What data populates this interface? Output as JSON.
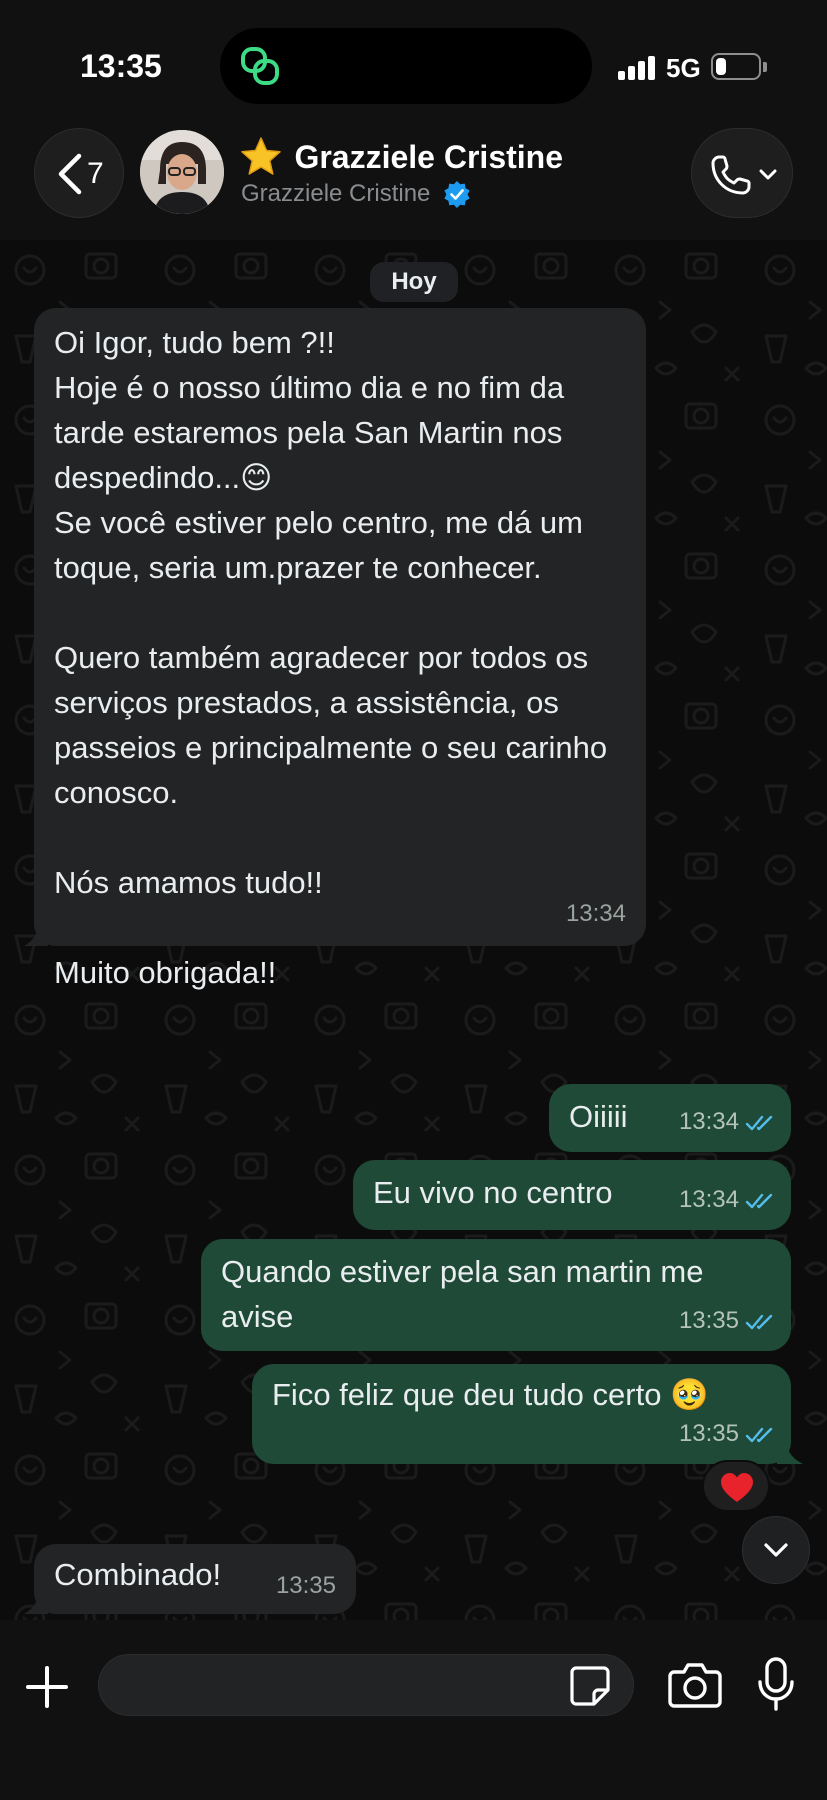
{
  "status_bar": {
    "time": "13:35",
    "network": "5G",
    "battery_level": 0.25
  },
  "header": {
    "back_count": "7",
    "contact_name": "Grazziele Cristine",
    "contact_subtitle": "Grazziele Cristine",
    "name_emoji": "star-icon",
    "verified": true
  },
  "chat": {
    "date_label": "Hoy",
    "messages": [
      {
        "direction": "incoming",
        "text": "Oi Igor, tudo bem ?!!\nHoje é o nosso último dia e no fim da tarde estaremos pela San Martin nos despedindo...😊\nSe você estiver pelo centro, me dá um toque, seria um.prazer te conhecer.\n\nQuero também agradecer por todos os serviços prestados, a assistência, os passeios e principalmente o seu carinho conosco.\n\nNós amamos tudo!!\n\nMuito obrigada!!",
        "time": "13:34"
      },
      {
        "direction": "outgoing",
        "text": "Oiiiii",
        "time": "13:34",
        "status": "read"
      },
      {
        "direction": "outgoing",
        "text": "Eu vivo no centro",
        "time": "13:34",
        "status": "read"
      },
      {
        "direction": "outgoing",
        "text": "Quando estiver pela san martin me avise",
        "time": "13:35",
        "status": "read"
      },
      {
        "direction": "outgoing",
        "text": "Fico feliz que deu tudo certo 🥹",
        "time": "13:35",
        "status": "read",
        "reaction": "❤️"
      },
      {
        "direction": "incoming",
        "text": "Combinado!",
        "time": "13:35"
      }
    ]
  },
  "composer": {
    "placeholder": ""
  },
  "colors": {
    "background": "#0b0b0b",
    "incoming_bubble": "#232425",
    "outgoing_bubble": "#1f4a37",
    "read_ticks": "#53bdeb",
    "verified_badge": "#1d9bf0",
    "island_link_icon": "#3ddc84"
  }
}
